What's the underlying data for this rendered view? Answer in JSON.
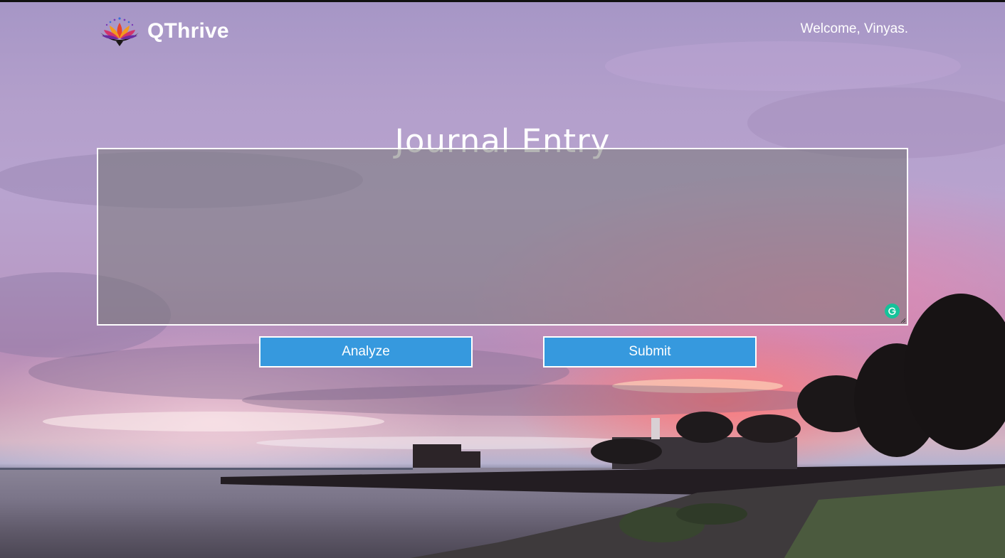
{
  "brand": {
    "name": "QThrive",
    "logo_icon": "lotus-logo-icon"
  },
  "header": {
    "welcome_text": "Welcome, Vinyas."
  },
  "main": {
    "title": "Journal Entry",
    "journal": {
      "value": "",
      "placeholder": ""
    },
    "buttons": {
      "analyze_label": "Analyze",
      "submit_label": "Submit"
    }
  },
  "colors": {
    "button_bg": "#3699de",
    "text": "#ffffff",
    "grammarly": "#15c39a",
    "textarea_bg": "rgba(120,120,120,0.55)"
  }
}
